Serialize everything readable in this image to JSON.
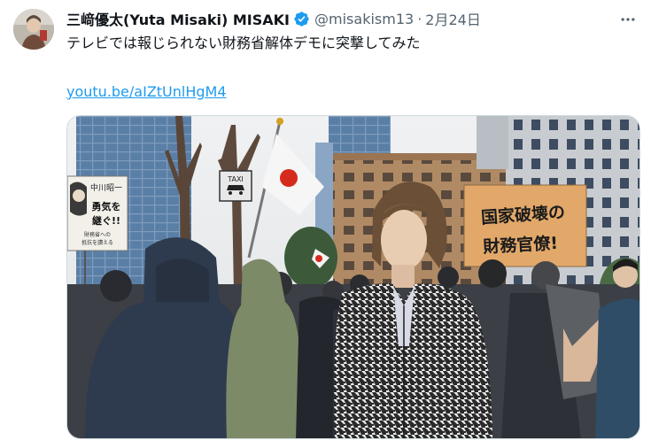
{
  "tweet": {
    "author": {
      "display_name": "三﨑優太(Yuta Misaki) MISAKI",
      "handle": "@misakism13",
      "verified_icon": "verified-badge-icon"
    },
    "separator": "·",
    "date": "2月24日",
    "text": "テレビでは報じられない財務省解体デモに突撃してみた",
    "link": "youtu.be/aIZtUnlHgM4",
    "more_icon": "more-options-icon"
  },
  "media": {
    "sign_left": {
      "lines": [
        "中川昭一",
        "勇気を",
        "継ぐ!!"
      ],
      "small_lines": [
        "財務省への",
        "抵抗を讃える"
      ]
    },
    "sign_right": {
      "line1": "国家破壊の",
      "line2": "財務官僚!"
    },
    "taxi_sign": "TAXI"
  },
  "colors": {
    "link": "#1d9bf0",
    "verified": "#1d9bf0",
    "secondary_text": "#536471",
    "primary_text": "#0f1419"
  }
}
